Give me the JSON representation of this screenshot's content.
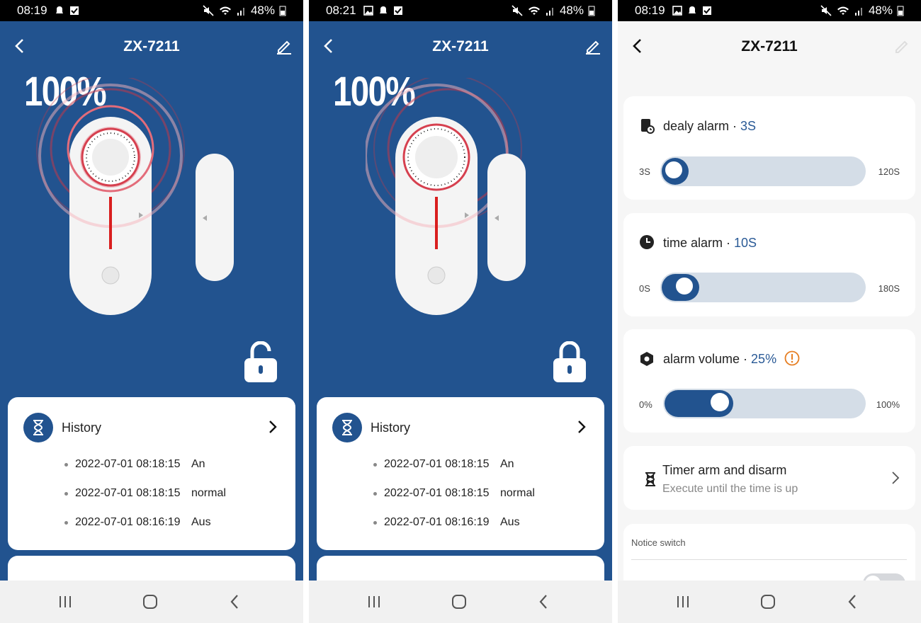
{
  "status_bars": [
    {
      "time": "08:19",
      "battery": "48%"
    },
    {
      "time": "08:21",
      "battery": "48%"
    },
    {
      "time": "08:19",
      "battery": "48%"
    }
  ],
  "device": {
    "name": "ZX-7211",
    "battery": "100%"
  },
  "history": {
    "title": "History",
    "entries": [
      {
        "timestamp": "2022-07-01 08:18:15",
        "event": "An"
      },
      {
        "timestamp": "2022-07-01 08:18:15",
        "event": "normal"
      },
      {
        "timestamp": "2022-07-01 08:16:19",
        "event": "Aus"
      }
    ]
  },
  "settings": {
    "delay": {
      "label": "dealy alarm",
      "value": "3S",
      "min": "3S",
      "max": "120S",
      "level": 0
    },
    "time": {
      "label": "time alarm",
      "value": "10S",
      "min": "0S",
      "max": "180S",
      "level": 0.06
    },
    "volume": {
      "label": "alarm volume",
      "value": "25%",
      "min": "0%",
      "max": "100%",
      "level": 0.25
    },
    "timer": {
      "title": "Timer arm and disarm",
      "subtitle": "Execute until the time is up"
    },
    "notice": {
      "label": "Notice switch"
    }
  },
  "colors": {
    "brand_blue": "#22538f",
    "alert": "#e74c3c",
    "warning": "#e67e22"
  },
  "icons": [
    "back-arrow-icon",
    "edit-pencil-icon",
    "unlock-icon",
    "hourglass-icon",
    "chevron-right-icon",
    "delay-alarm-icon",
    "clock-icon",
    "volume-hex-icon",
    "warning-icon",
    "timer-hourglass-icon",
    "recents-icon",
    "home-icon",
    "nav-back-icon"
  ]
}
